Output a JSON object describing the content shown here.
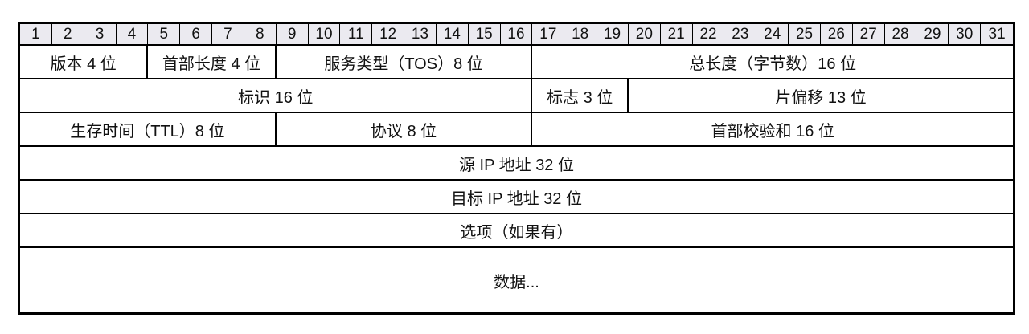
{
  "bits": [
    "1",
    "2",
    "3",
    "4",
    "5",
    "6",
    "7",
    "8",
    "9",
    "10",
    "11",
    "12",
    "13",
    "14",
    "15",
    "16",
    "17",
    "18",
    "19",
    "20",
    "21",
    "22",
    "23",
    "24",
    "25",
    "26",
    "27",
    "28",
    "29",
    "30",
    "31"
  ],
  "fields": {
    "version": "版本 4 位",
    "header_length": "首部长度 4 位",
    "tos": "服务类型（TOS）8 位",
    "total_length": "总长度（字节数）16 位",
    "identification": "标识 16 位",
    "flags": "标志 3 位",
    "fragment_offset": "片偏移 13 位",
    "ttl": "生存时间（TTL）8 位",
    "protocol": "协议 8 位",
    "checksum": "首部校验和 16 位",
    "source_ip": "源 IP 地址 32 位",
    "dest_ip": "目标 IP 地址 32 位",
    "options": "选项（如果有）",
    "data": "数据..."
  },
  "colors": {
    "header_bg": "#ebeaf0",
    "border": "#000000"
  }
}
